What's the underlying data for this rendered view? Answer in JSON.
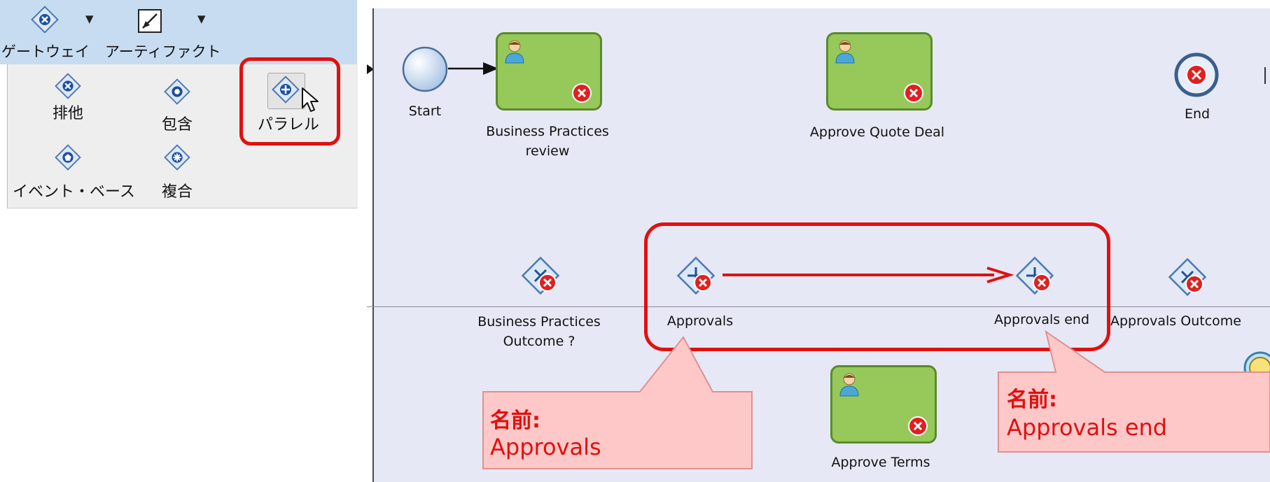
{
  "palette": {
    "header": {
      "gateway_label": "ゲートウェイ",
      "artifact_label": "アーティファクト"
    },
    "items": {
      "exclusive": "排他",
      "inclusive": "包含",
      "parallel": "パラレル",
      "event_based": "イベント・ベース",
      "complex": "複合"
    }
  },
  "diagram": {
    "start_label": "Start",
    "task_business_practices": "Business Practices\nreview",
    "task_approve_quote": "Approve Quote Deal",
    "end_label": "End",
    "gateway_bp_outcome": "Business Practices\nOutcome ?",
    "gateway_approvals": "Approvals",
    "gateway_approvals_end": "Approvals end",
    "gateway_approvals_outcome": "Approvals Outcome",
    "task_approve_terms": "Approve Terms"
  },
  "callouts": {
    "left": {
      "name_label": "名前:",
      "value": "Approvals"
    },
    "right": {
      "name_label": "名前:",
      "value": "Approvals end"
    }
  },
  "colors": {
    "highlight": "#e01010",
    "task_fill": "#97c95a",
    "canvas": "#e6e8f5",
    "callout_fill": "#ffc8c8"
  }
}
